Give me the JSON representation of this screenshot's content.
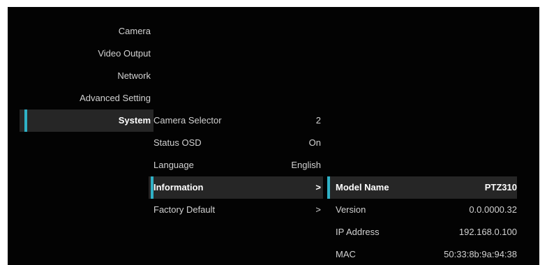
{
  "main_menu": {
    "items": [
      {
        "label": "Camera"
      },
      {
        "label": "Video Output"
      },
      {
        "label": "Network"
      },
      {
        "label": "Advanced Setting"
      },
      {
        "label": "System"
      }
    ],
    "selected": "System"
  },
  "system_menu": {
    "items": [
      {
        "label": "Camera Selector",
        "value": "2"
      },
      {
        "label": "Status OSD",
        "value": "On"
      },
      {
        "label": "Language",
        "value": "English"
      },
      {
        "label": "Information",
        "value": ">"
      },
      {
        "label": "Factory Default",
        "value": ">"
      }
    ],
    "selected": "Information"
  },
  "information_panel": {
    "items": [
      {
        "label": "Model Name",
        "value": "PTZ310"
      },
      {
        "label": "Version",
        "value": "0.0.0000.32"
      },
      {
        "label": "IP Address",
        "value": "192.168.0.100"
      },
      {
        "label": "MAC",
        "value": "50:33:8b:9a:94:38"
      }
    ],
    "selected": "Model Name"
  },
  "colors": {
    "background": "#030303",
    "text": "#d2d2d2",
    "selected_background": "#262626",
    "accent": "#2fb1c6"
  }
}
